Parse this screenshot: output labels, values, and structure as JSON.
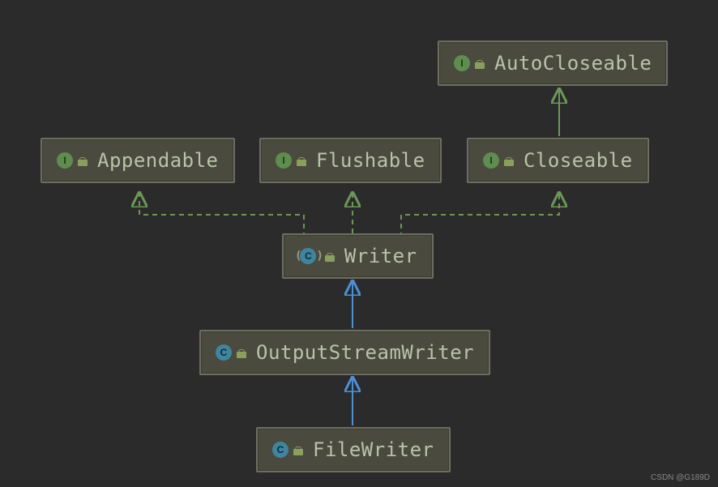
{
  "chart_data": {
    "type": "class-hierarchy",
    "nodes": [
      {
        "id": "autocloseable",
        "label": "AutoCloseable",
        "kind": "interface"
      },
      {
        "id": "appendable",
        "label": "Appendable",
        "kind": "interface"
      },
      {
        "id": "flushable",
        "label": "Flushable",
        "kind": "interface"
      },
      {
        "id": "closeable",
        "label": "Closeable",
        "kind": "interface"
      },
      {
        "id": "writer",
        "label": "Writer",
        "kind": "abstract-class"
      },
      {
        "id": "outputstreamwriter",
        "label": "OutputStreamWriter",
        "kind": "class"
      },
      {
        "id": "filewriter",
        "label": "FileWriter",
        "kind": "class"
      }
    ],
    "edges": [
      {
        "from": "closeable",
        "to": "autocloseable",
        "relation": "extends",
        "style": "solid"
      },
      {
        "from": "writer",
        "to": "appendable",
        "relation": "implements",
        "style": "dashed"
      },
      {
        "from": "writer",
        "to": "flushable",
        "relation": "implements",
        "style": "dashed"
      },
      {
        "from": "writer",
        "to": "closeable",
        "relation": "implements",
        "style": "dashed"
      },
      {
        "from": "outputstreamwriter",
        "to": "writer",
        "relation": "extends",
        "style": "solid"
      },
      {
        "from": "filewriter",
        "to": "outputstreamwriter",
        "relation": "extends",
        "style": "solid"
      }
    ]
  },
  "nodes": {
    "autocloseable": {
      "label": "AutoCloseable",
      "badge": "I"
    },
    "appendable": {
      "label": "Appendable",
      "badge": "I"
    },
    "flushable": {
      "label": "Flushable",
      "badge": "I"
    },
    "closeable": {
      "label": "Closeable",
      "badge": "I"
    },
    "writer": {
      "label": "Writer",
      "badge": "C"
    },
    "outputstreamwriter": {
      "label": "OutputStreamWriter",
      "badge": "C"
    },
    "filewriter": {
      "label": "FileWriter",
      "badge": "C"
    }
  },
  "watermark": "CSDN @G189D"
}
